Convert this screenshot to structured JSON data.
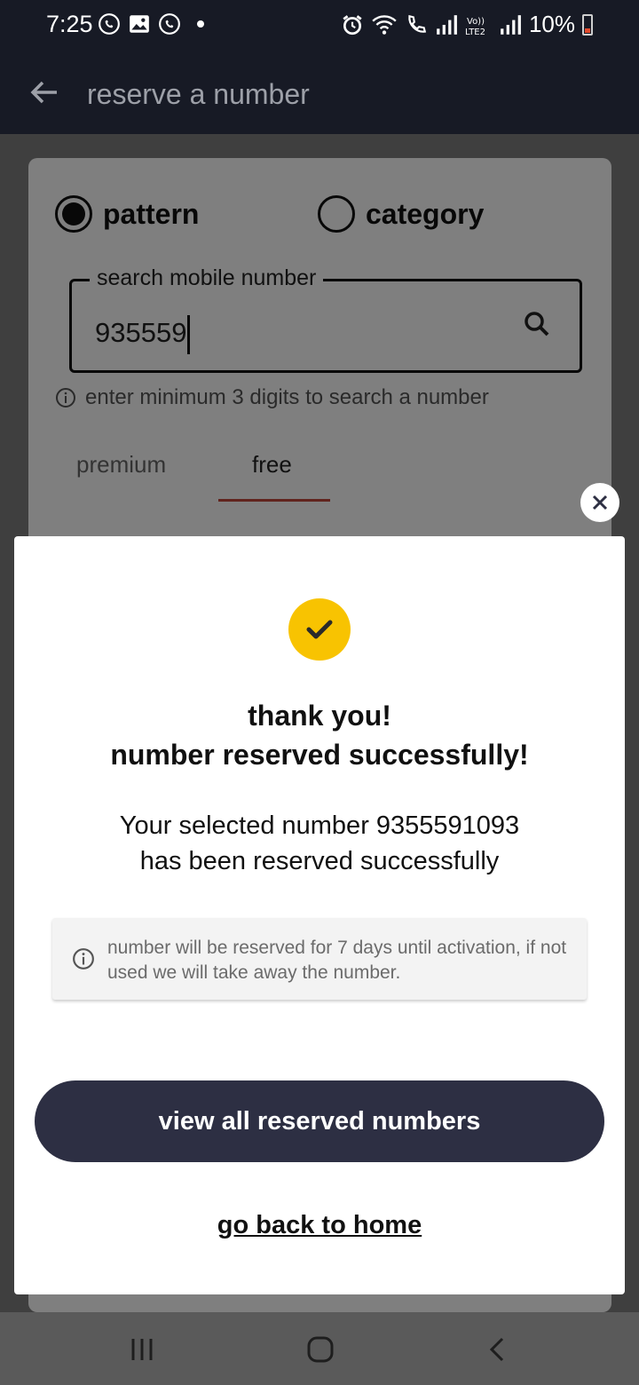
{
  "status_bar": {
    "time": "7:25",
    "left_icons": [
      "whatsapp-icon",
      "gallery-icon",
      "whatsapp-icon",
      "dot-icon"
    ],
    "right_icons": [
      "alarm-icon",
      "wifi-icon",
      "call-icon",
      "signal-icon",
      "volte-lte2-icon",
      "signal-icon"
    ],
    "battery": "10%"
  },
  "app_bar": {
    "title": "reserve a number",
    "back_icon": "arrow-left-icon"
  },
  "search_form": {
    "options": [
      {
        "label": "pattern",
        "selected": true
      },
      {
        "label": "category",
        "selected": false
      }
    ],
    "field_label": "search mobile number",
    "value": "935559",
    "hint": "enter minimum 3 digits to search a number",
    "tabs": [
      {
        "label": "premium",
        "active": false
      },
      {
        "label": "free",
        "active": true
      }
    ]
  },
  "modal": {
    "title_line1": "thank you!",
    "title_line2": "number reserved successfully!",
    "message_line1": "Your selected number 9355591093",
    "message_line2": "has been reserved successfully",
    "note": "number will be reserved for 7 days until activation, if not used we will take away the number.",
    "primary_button": "view all reserved numbers",
    "link": "go back to home",
    "accent_color": "#f8c301",
    "button_color": "#2d2f43"
  },
  "nav_bar": {
    "buttons": [
      "recents-icon",
      "home-icon",
      "back-icon"
    ]
  }
}
